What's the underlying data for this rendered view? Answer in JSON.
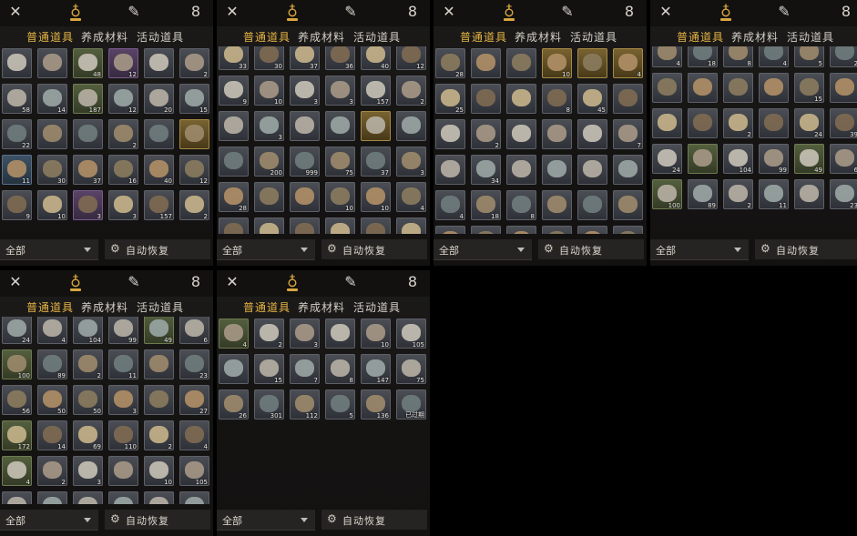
{
  "tabs": [
    "普通道具",
    "养成材料",
    "活动道具"
  ],
  "active_tab": "普通道具",
  "filter_label": "全部",
  "restore_label": "自动恢复",
  "icons": {
    "left": "crossed-swords-icon",
    "center": "money-bag-icon",
    "right_a": "brush-icon",
    "right_b": "gourd-icon"
  },
  "panels": [
    {
      "id": "p1",
      "rows": [
        [
          {
            "q": "",
            "r": "gray"
          },
          {
            "q": "",
            "r": "gray"
          },
          {
            "q": "48",
            "r": "green"
          },
          {
            "q": "12",
            "r": "purple"
          },
          {
            "q": "",
            "r": "gray"
          },
          {
            "q": "2",
            "r": "gray"
          }
        ],
        [
          {
            "q": "58",
            "r": "gray"
          },
          {
            "q": "14",
            "r": "gray"
          },
          {
            "q": "187",
            "r": "green"
          },
          {
            "q": "12",
            "r": "gray"
          },
          {
            "q": "20",
            "r": "gray"
          },
          {
            "q": "15",
            "r": "gray"
          }
        ],
        [
          {
            "q": "22",
            "r": "gray"
          },
          {
            "q": "",
            "r": "gray"
          },
          {
            "q": "",
            "r": "gray"
          },
          {
            "q": "2",
            "r": "gray"
          },
          {
            "q": "",
            "r": "gray"
          },
          {
            "q": "",
            "r": "gold"
          }
        ],
        [
          {
            "q": "11",
            "r": "blue"
          },
          {
            "q": "30",
            "r": "gray"
          },
          {
            "q": "37",
            "r": "gray"
          },
          {
            "q": "16",
            "r": "gray"
          },
          {
            "q": "40",
            "r": "gray"
          },
          {
            "q": "12",
            "r": "gray"
          }
        ],
        [
          {
            "q": "9",
            "r": "gray"
          },
          {
            "q": "10",
            "r": "gray"
          },
          {
            "q": "3",
            "r": "purple"
          },
          {
            "q": "3",
            "r": "gray"
          },
          {
            "q": "157",
            "r": "gray"
          },
          {
            "q": "2",
            "r": "gray"
          }
        ]
      ]
    },
    {
      "id": "p2",
      "rows": [
        [
          {
            "q": "33",
            "r": "gray"
          },
          {
            "q": "30",
            "r": "gray"
          },
          {
            "q": "37",
            "r": "gray"
          },
          {
            "q": "36",
            "r": "gray"
          },
          {
            "q": "40",
            "r": "gray"
          },
          {
            "q": "12",
            "r": "gray"
          }
        ],
        [
          {
            "q": "9",
            "r": "gray"
          },
          {
            "q": "10",
            "r": "gray"
          },
          {
            "q": "3",
            "r": "gray"
          },
          {
            "q": "3",
            "r": "gray"
          },
          {
            "q": "157",
            "r": "gray"
          },
          {
            "q": "2",
            "r": "gray"
          }
        ],
        [
          {
            "q": "",
            "r": "gray"
          },
          {
            "q": "3",
            "r": "gray"
          },
          {
            "q": "",
            "r": "gray"
          },
          {
            "q": "",
            "r": "gray"
          },
          {
            "q": "",
            "r": "gold"
          },
          {
            "q": "",
            "r": "gray"
          }
        ],
        [
          {
            "q": "",
            "r": "gray"
          },
          {
            "q": "200",
            "r": "gray"
          },
          {
            "q": "999",
            "r": "gray"
          },
          {
            "q": "75",
            "r": "gray"
          },
          {
            "q": "37",
            "r": "gray"
          },
          {
            "q": "3",
            "r": "gray"
          }
        ],
        [
          {
            "q": "28",
            "r": "gray"
          },
          {
            "q": "",
            "r": "gray"
          },
          {
            "q": "",
            "r": "gray"
          },
          {
            "q": "10",
            "r": "gray"
          },
          {
            "q": "10",
            "r": "gray"
          },
          {
            "q": "4",
            "r": "gray"
          }
        ],
        [
          {
            "q": "",
            "r": "gray"
          },
          {
            "q": "",
            "r": "gray"
          },
          {
            "q": "",
            "r": "gray"
          },
          {
            "q": "",
            "r": "gray"
          },
          {
            "q": "",
            "r": "gray"
          },
          {
            "q": "",
            "r": "gray"
          }
        ]
      ]
    },
    {
      "id": "p3",
      "rows": [
        [
          {
            "q": "28",
            "r": "gray"
          },
          {
            "q": "",
            "r": "gray"
          },
          {
            "q": "",
            "r": "gray"
          },
          {
            "q": "10",
            "r": "gold"
          },
          {
            "q": "",
            "r": "gold"
          },
          {
            "q": "4",
            "r": "gold"
          }
        ],
        [
          {
            "q": "25",
            "r": "gray"
          },
          {
            "q": "",
            "r": "gray"
          },
          {
            "q": "",
            "r": "gray"
          },
          {
            "q": "8",
            "r": "gray"
          },
          {
            "q": "45",
            "r": "gray"
          },
          {
            "q": "",
            "r": "gray"
          }
        ],
        [
          {
            "q": "",
            "r": "gray"
          },
          {
            "q": "2",
            "r": "gray"
          },
          {
            "q": "",
            "r": "gray"
          },
          {
            "q": "",
            "r": "gray"
          },
          {
            "q": "",
            "r": "gray"
          },
          {
            "q": "7",
            "r": "gray"
          }
        ],
        [
          {
            "q": "",
            "r": "gray"
          },
          {
            "q": "34",
            "r": "gray"
          },
          {
            "q": "",
            "r": "gray"
          },
          {
            "q": "",
            "r": "gray"
          },
          {
            "q": "",
            "r": "gray"
          },
          {
            "q": "",
            "r": "gray"
          }
        ],
        [
          {
            "q": "4",
            "r": "gray"
          },
          {
            "q": "18",
            "r": "gray"
          },
          {
            "q": "8",
            "r": "gray"
          },
          {
            "q": "",
            "r": "gray"
          },
          {
            "q": "",
            "r": "gray"
          },
          {
            "q": "",
            "r": "gray"
          }
        ],
        [
          {
            "q": "",
            "r": "gray"
          },
          {
            "q": "",
            "r": "gray"
          },
          {
            "q": "",
            "r": "gray"
          },
          {
            "q": "",
            "r": "gray"
          },
          {
            "q": "",
            "r": "gray"
          },
          {
            "q": "",
            "r": "gray"
          }
        ]
      ]
    },
    {
      "id": "p4",
      "rows": [
        [
          {
            "q": "4",
            "r": "gray"
          },
          {
            "q": "18",
            "r": "gray"
          },
          {
            "q": "8",
            "r": "gray"
          },
          {
            "q": "4",
            "r": "gray"
          },
          {
            "q": "5",
            "r": "gray"
          },
          {
            "q": "2",
            "r": "gray"
          }
        ],
        [
          {
            "q": "",
            "r": "gray"
          },
          {
            "q": "",
            "r": "gray"
          },
          {
            "q": "",
            "r": "gray"
          },
          {
            "q": "",
            "r": "gray"
          },
          {
            "q": "15",
            "r": "gray"
          },
          {
            "q": "",
            "r": "gray"
          }
        ],
        [
          {
            "q": "",
            "r": "gray"
          },
          {
            "q": "",
            "r": "gray"
          },
          {
            "q": "2",
            "r": "gray"
          },
          {
            "q": "",
            "r": "gray"
          },
          {
            "q": "24",
            "r": "gray"
          },
          {
            "q": "39",
            "r": "gray"
          }
        ],
        [
          {
            "q": "24",
            "r": "gray"
          },
          {
            "q": "",
            "r": "green"
          },
          {
            "q": "104",
            "r": "gray"
          },
          {
            "q": "99",
            "r": "gray"
          },
          {
            "q": "49",
            "r": "green"
          },
          {
            "q": "6",
            "r": "gray"
          }
        ],
        [
          {
            "q": "100",
            "r": "green"
          },
          {
            "q": "89",
            "r": "gray"
          },
          {
            "q": "2",
            "r": "gray"
          },
          {
            "q": "11",
            "r": "gray"
          },
          {
            "q": "",
            "r": "gray"
          },
          {
            "q": "23",
            "r": "gray"
          }
        ]
      ]
    },
    {
      "id": "p5",
      "rows": [
        [
          {
            "q": "24",
            "r": "gray"
          },
          {
            "q": "4",
            "r": "gray"
          },
          {
            "q": "104",
            "r": "gray"
          },
          {
            "q": "99",
            "r": "gray"
          },
          {
            "q": "49",
            "r": "green"
          },
          {
            "q": "6",
            "r": "gray"
          }
        ],
        [
          {
            "q": "100",
            "r": "green"
          },
          {
            "q": "89",
            "r": "gray"
          },
          {
            "q": "2",
            "r": "gray"
          },
          {
            "q": "11",
            "r": "gray"
          },
          {
            "q": "",
            "r": "gray"
          },
          {
            "q": "23",
            "r": "gray"
          }
        ],
        [
          {
            "q": "56",
            "r": "gray"
          },
          {
            "q": "50",
            "r": "gray"
          },
          {
            "q": "50",
            "r": "gray"
          },
          {
            "q": "3",
            "r": "gray"
          },
          {
            "q": "",
            "r": "gray"
          },
          {
            "q": "27",
            "r": "gray"
          }
        ],
        [
          {
            "q": "172",
            "r": "green"
          },
          {
            "q": "14",
            "r": "gray"
          },
          {
            "q": "69",
            "r": "gray"
          },
          {
            "q": "110",
            "r": "gray"
          },
          {
            "q": "2",
            "r": "gray"
          },
          {
            "q": "4",
            "r": "gray"
          }
        ],
        [
          {
            "q": "4",
            "r": "green"
          },
          {
            "q": "2",
            "r": "gray"
          },
          {
            "q": "3",
            "r": "gray"
          },
          {
            "q": "",
            "r": "gray"
          },
          {
            "q": "10",
            "r": "gray"
          },
          {
            "q": "105",
            "r": "gray"
          }
        ],
        [
          {
            "q": "",
            "r": "gray"
          },
          {
            "q": "",
            "r": "gray"
          },
          {
            "q": "",
            "r": "gray"
          },
          {
            "q": "",
            "r": "gray"
          },
          {
            "q": "",
            "r": "gray"
          },
          {
            "q": "",
            "r": "gray"
          }
        ]
      ]
    },
    {
      "id": "p6",
      "rows": [
        [
          {
            "q": "4",
            "r": "green"
          },
          {
            "q": "2",
            "r": "gray"
          },
          {
            "q": "3",
            "r": "gray"
          },
          {
            "q": "",
            "r": "gray"
          },
          {
            "q": "10",
            "r": "gray"
          },
          {
            "q": "105",
            "r": "gray"
          }
        ],
        [
          {
            "q": "",
            "r": "gray"
          },
          {
            "q": "15",
            "r": "gray"
          },
          {
            "q": "7",
            "r": "gray"
          },
          {
            "q": "8",
            "r": "gray"
          },
          {
            "q": "147",
            "r": "gray"
          },
          {
            "q": "75",
            "r": "gray"
          }
        ],
        [
          {
            "q": "26",
            "r": "gray"
          },
          {
            "q": "301",
            "r": "gray"
          },
          {
            "q": "112",
            "r": "gray"
          },
          {
            "q": "5",
            "r": "gray"
          },
          {
            "q": "136",
            "r": "gray"
          },
          {
            "q": "已过期",
            "r": "gray"
          }
        ]
      ]
    }
  ]
}
